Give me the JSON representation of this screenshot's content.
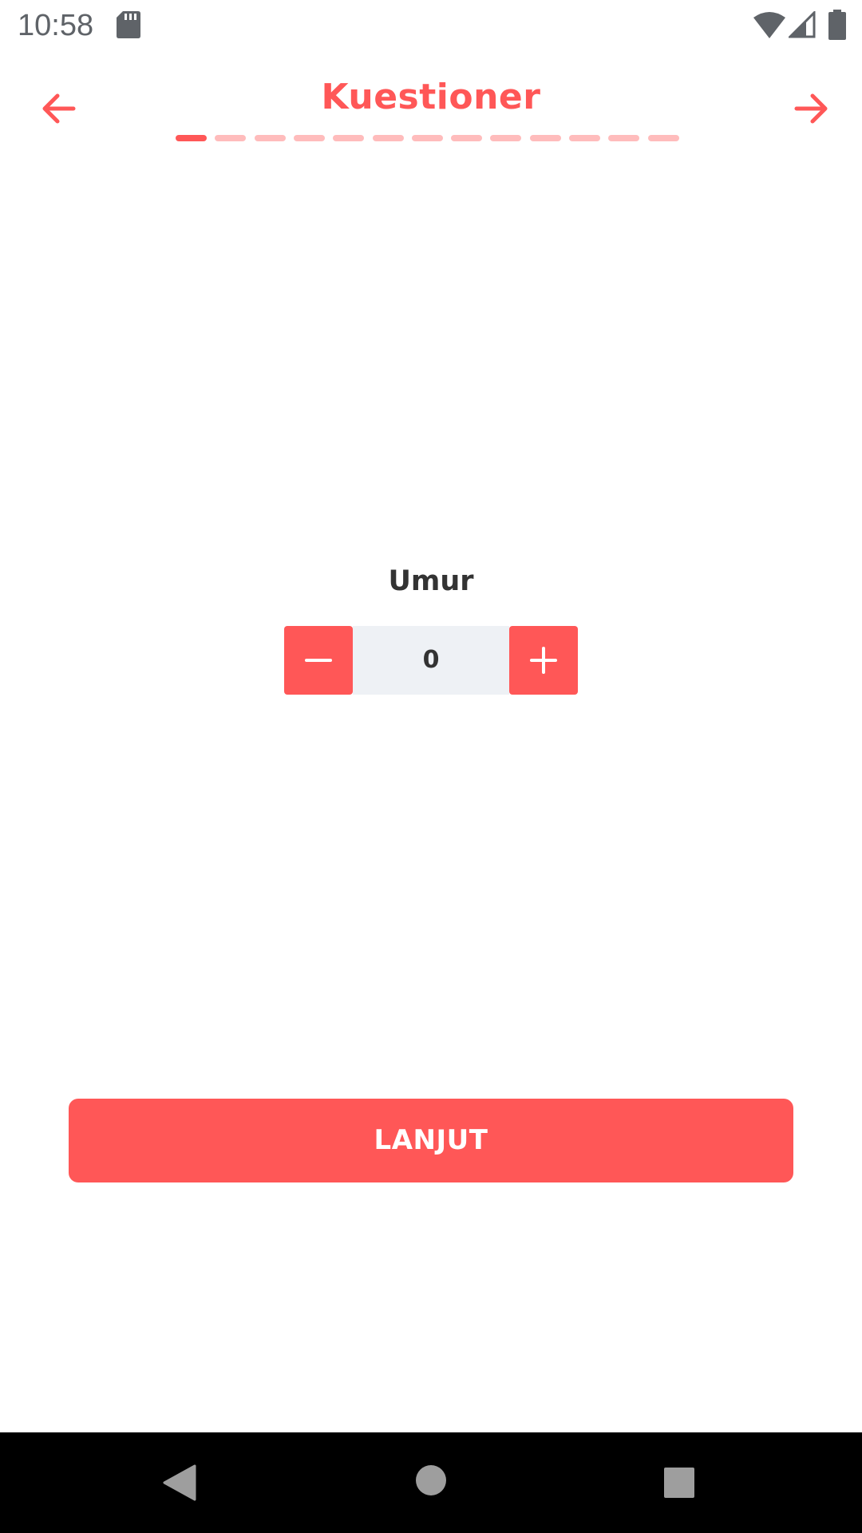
{
  "status_bar": {
    "time": "10:58",
    "icons": [
      "sd-card-icon",
      "wifi-icon",
      "signal-icon",
      "battery-icon"
    ]
  },
  "header": {
    "title": "Kuestioner",
    "back_icon": "arrow-left-icon",
    "forward_icon": "arrow-right-icon"
  },
  "progress": {
    "total_steps": 13,
    "current_step": 1
  },
  "question": {
    "label": "Umur",
    "value": "0",
    "decrement_icon": "minus-icon",
    "increment_icon": "plus-icon"
  },
  "footer": {
    "continue_label": "LANJUT"
  },
  "system_nav": {
    "buttons": [
      "back-triangle-icon",
      "home-circle-icon",
      "recents-square-icon"
    ]
  },
  "colors": {
    "accent": "#ff5757",
    "accent_light": "#ffbcbc",
    "stepper_bg": "#eef1f5",
    "text_dark": "#333333"
  }
}
